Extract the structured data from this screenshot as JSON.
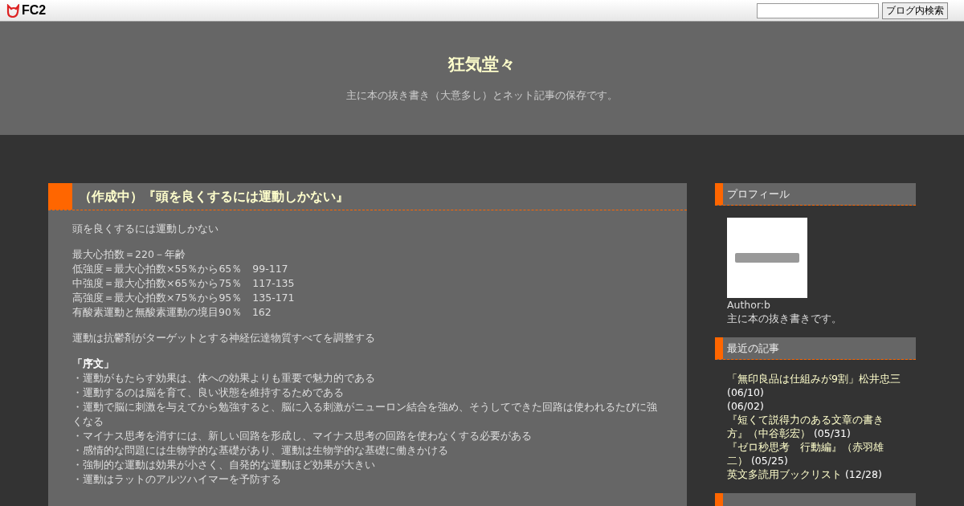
{
  "topbar": {
    "logo": "FC2",
    "search_button": "ブログ内検索"
  },
  "header": {
    "title": "狂気堂々",
    "description": "主に本の抜き書き（大意多し）とネット記事の保存です。"
  },
  "article": {
    "title": "（作成中）『頭を良くするには運動しかない』",
    "blocks": [
      {
        "kind": "para",
        "lines": [
          "頭を良くするには運動しかない"
        ]
      },
      {
        "kind": "para",
        "lines": [
          "最大心拍数＝220－年齢",
          "低強度＝最大心拍数×55％から65％　99-117",
          "中強度＝最大心拍数×65％から75％　117-135",
          "高強度＝最大心拍数×75％から95％　135-171",
          "有酸素運動と無酸素運動の境目90％　162"
        ]
      },
      {
        "kind": "para",
        "lines": [
          "運動は抗鬱剤がターゲットとする神経伝達物質すべてを調整する"
        ]
      },
      {
        "kind": "section",
        "heading": "「序文」",
        "lines": [
          "・運動がもたらす効果は、体への効果よりも重要で魅力的である",
          "・運動するのは脳を育て、良い状態を維持するためである",
          "・運動で脳に刺激を与えてから勉強すると、脳に入る刺激がニューロン結合を強め、そうしてできた回路は使われるたびに強くなる",
          "・マイナス思考を消すには、新しい回路を形成し、マイナス思考の回路を使わなくする必要がある",
          "・感情的な問題には生物学的な基礎があり、運動は生物学的な基礎に働きかける",
          "・強制的な運動は効果が小さく、自発的な運動ほど効果が大きい",
          "・運動はラットのアルツハイマーを予防する"
        ]
      }
    ]
  },
  "sidebar": [
    {
      "kind": "profile",
      "title": "プロフィール",
      "author": "Author:b",
      "bio": "主に本の抜き書きです。"
    },
    {
      "kind": "entries",
      "title": "最近の記事",
      "items": [
        {
          "title": "「無印良品は仕組みが9割」松井忠三",
          "date": "(06/10)"
        },
        {
          "date": "(06/02)"
        },
        {
          "title": "『短くて説得力のある文章の書き方』（中谷彰宏）",
          "date": "(05/31)"
        },
        {
          "title": "『ゼロ秒思考　行動編』（赤羽雄二）",
          "date": "(05/25)"
        },
        {
          "title": "英文多読用ブックリスト",
          "date": "(12/28)"
        }
      ]
    },
    {
      "kind": "bar-only"
    }
  ]
}
